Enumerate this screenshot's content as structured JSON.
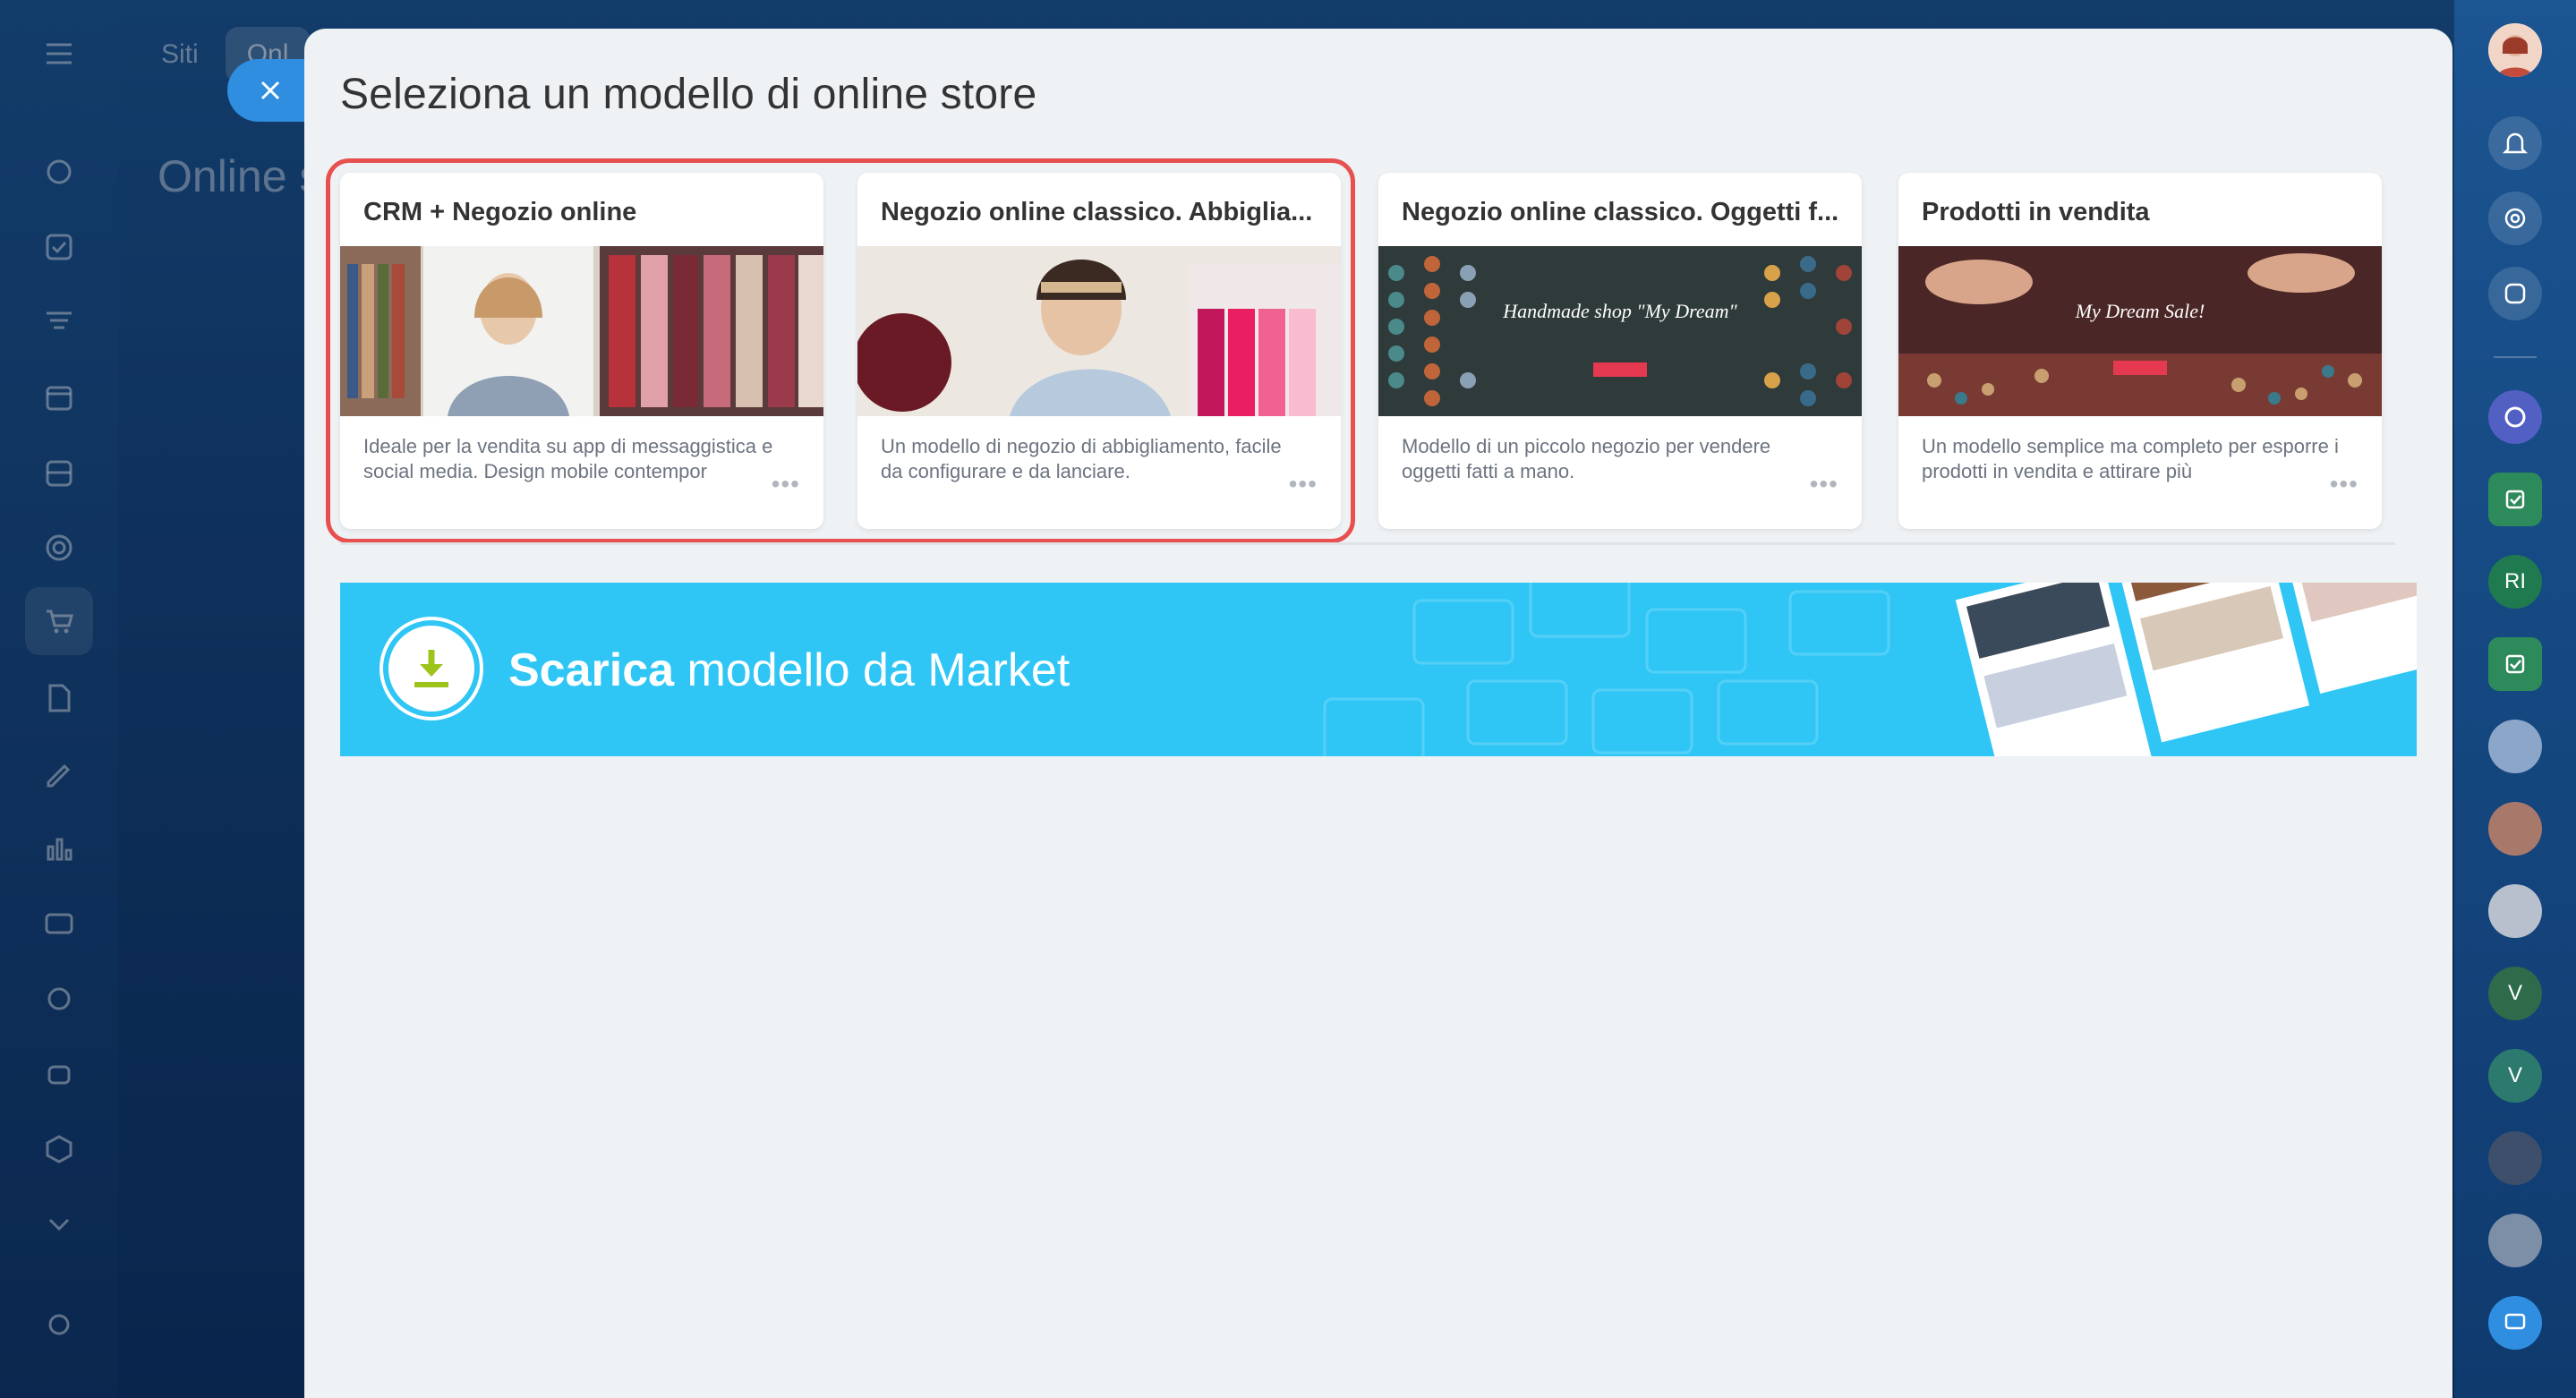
{
  "background": {
    "tabs": [
      "Siti",
      "Onl"
    ],
    "page_title": "Online s"
  },
  "slider": {
    "title": "Seleziona un modello di online store"
  },
  "cards": [
    {
      "title": "CRM + Negozio online",
      "description": "Ideale per la vendita su app di messaggistica e social media. Design mobile contempor"
    },
    {
      "title": "Negozio online classico. Abbiglia...",
      "description": "Un modello di negozio di abbigliamento, facile da configurare e da lanciare."
    },
    {
      "title": "Negozio online classico. Oggetti f...",
      "description": "Modello di un piccolo negozio per vendere oggetti fatti a mano.",
      "image_text": "Handmade shop \"My Dream\""
    },
    {
      "title": "Prodotti in vendita",
      "description": "Un modello semplice ma completo per esporre i prodotti in vendita e attirare più",
      "image_text": "My Dream Sale!"
    }
  ],
  "more_label": "•••",
  "market_banner": {
    "bold": "Scarica",
    "rest": " modello da Market"
  },
  "right_rail": {
    "initials_ri": "RI",
    "initials_v": "V"
  },
  "colors": {
    "accent": "#2fc6f6",
    "highlight": "#e8504f",
    "close_button": "#2f8ee0",
    "download_green": "#9dc41a"
  }
}
